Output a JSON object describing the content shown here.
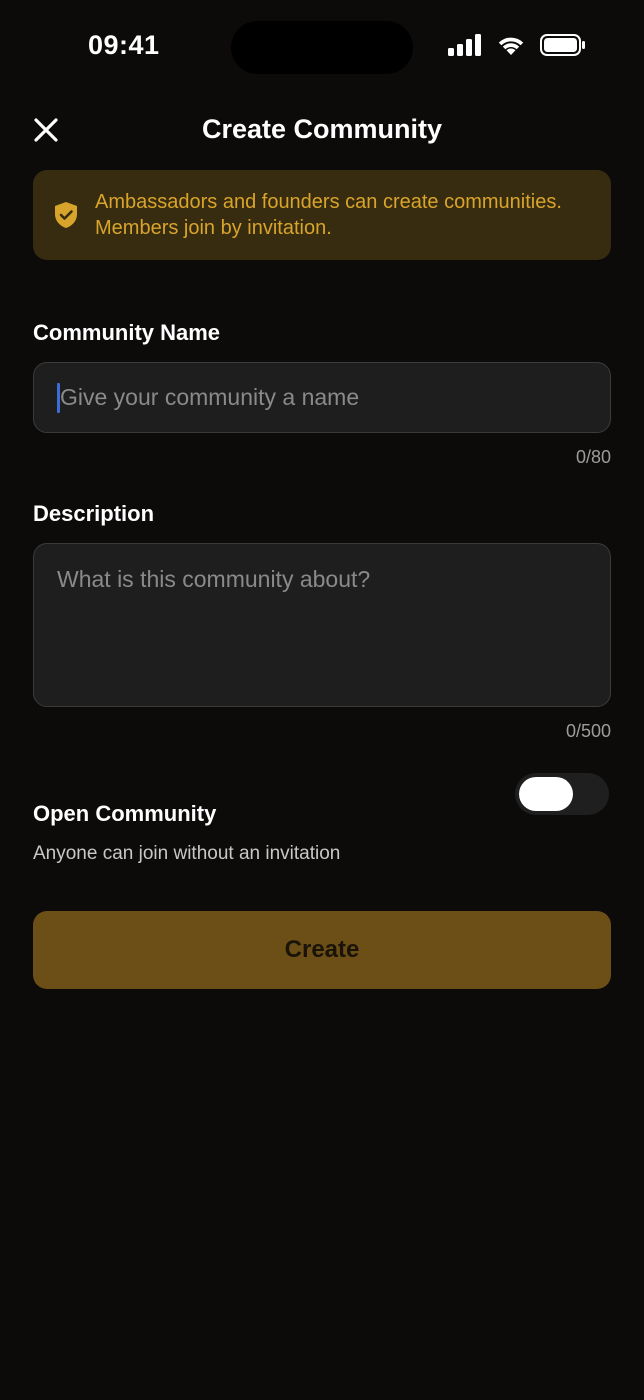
{
  "status_bar": {
    "time": "09:41",
    "icons": [
      "cellular-signal-icon",
      "wifi-icon",
      "battery-icon"
    ]
  },
  "header": {
    "close_icon": "close-icon",
    "title": "Create Community"
  },
  "banner": {
    "icon": "shield-check-icon",
    "text": "Ambassadors and founders can create communities. Members join by invitation.",
    "bg_color": "#372c0f",
    "text_color": "#d9a42c"
  },
  "form": {
    "name": {
      "label": "Community Name",
      "placeholder": "Give your community a name",
      "value": "",
      "counter": "0/80"
    },
    "description": {
      "label": "Description",
      "placeholder": "What is this community about?",
      "value": "",
      "counter": "0/500"
    },
    "open_community": {
      "label": "Open Community",
      "sublabel": "Anyone can join without an invitation",
      "enabled": false
    },
    "submit_label": "Create"
  },
  "colors": {
    "background": "#0d0b0a",
    "accent": "#6b4f17",
    "caret": "#3f6bd8"
  }
}
